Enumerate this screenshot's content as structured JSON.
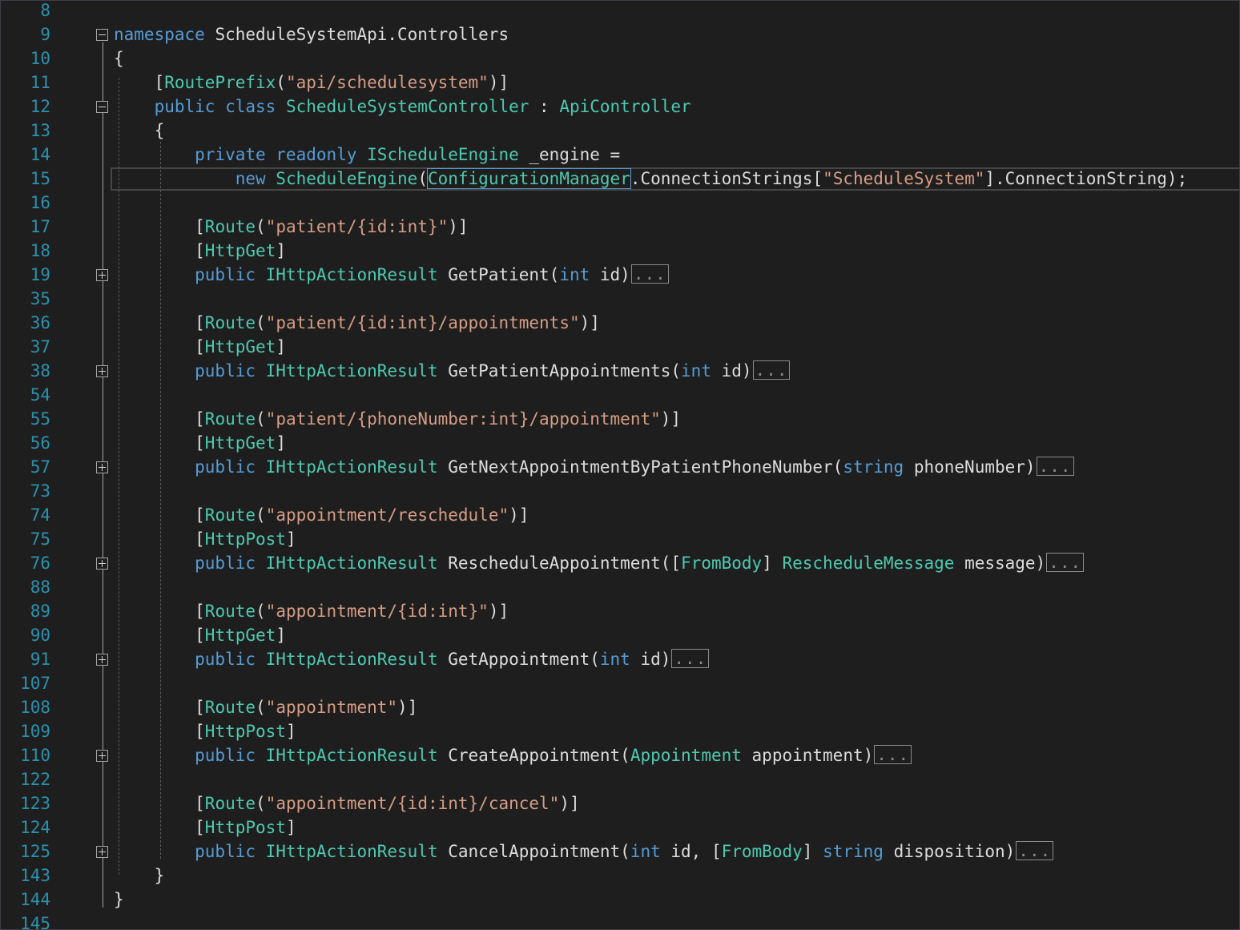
{
  "editor": {
    "colors": {
      "background": "#1e1e1e",
      "line_number": "#2b91af",
      "keyword": "#569cd6",
      "type": "#4ec9b0",
      "string": "#d69d85",
      "plain": "#dcdcdc"
    },
    "collapsed_marker": "...",
    "lines": [
      {
        "num": "8",
        "tokens": []
      },
      {
        "num": "9",
        "fold": "minus",
        "tokens": [
          [
            "kw",
            "namespace"
          ],
          [
            "pl",
            " ScheduleSystemApi.Controllers"
          ]
        ]
      },
      {
        "num": "10",
        "tokens": [
          [
            "pl",
            "{"
          ]
        ]
      },
      {
        "num": "11",
        "tokens": [
          [
            "pl",
            "    ["
          ],
          [
            "ty",
            "RoutePrefix"
          ],
          [
            "pl",
            "("
          ],
          [
            "st",
            "\"api/schedulesystem\""
          ],
          [
            "pl",
            ")]"
          ]
        ]
      },
      {
        "num": "12",
        "fold": "minus",
        "tokens": [
          [
            "kw",
            "    public class "
          ],
          [
            "ty",
            "ScheduleSystemController"
          ],
          [
            "pl",
            " : "
          ],
          [
            "ty",
            "ApiController"
          ]
        ]
      },
      {
        "num": "13",
        "tokens": [
          [
            "pl",
            "    {"
          ]
        ]
      },
      {
        "num": "14",
        "tokens": [
          [
            "kw",
            "        private readonly "
          ],
          [
            "ty",
            "IScheduleEngine"
          ],
          [
            "pl",
            " _engine ="
          ]
        ]
      },
      {
        "num": "15",
        "tokens": [
          [
            "kw",
            "            new "
          ],
          [
            "ty",
            "ScheduleEngine"
          ],
          [
            "pl",
            "("
          ],
          [
            "tyhl",
            "ConfigurationManager"
          ],
          [
            "pl",
            ".ConnectionStrings["
          ],
          [
            "st",
            "\"ScheduleSystem\""
          ],
          [
            "pl",
            "].ConnectionString);"
          ]
        ]
      },
      {
        "num": "16",
        "tokens": []
      },
      {
        "num": "17",
        "tokens": [
          [
            "pl",
            "        ["
          ],
          [
            "ty",
            "Route"
          ],
          [
            "pl",
            "("
          ],
          [
            "st",
            "\"patient/{id:int}\""
          ],
          [
            "pl",
            ")]"
          ]
        ]
      },
      {
        "num": "18",
        "tokens": [
          [
            "pl",
            "        ["
          ],
          [
            "ty",
            "HttpGet"
          ],
          [
            "pl",
            "]"
          ]
        ]
      },
      {
        "num": "19",
        "fold": "plus",
        "collapsed": true,
        "tokens": [
          [
            "kw",
            "        public "
          ],
          [
            "ty",
            "IHttpActionResult"
          ],
          [
            "pl",
            " GetPatient("
          ],
          [
            "kw",
            "int"
          ],
          [
            "pl",
            " id)"
          ]
        ]
      },
      {
        "num": "35",
        "tokens": []
      },
      {
        "num": "36",
        "tokens": [
          [
            "pl",
            "        ["
          ],
          [
            "ty",
            "Route"
          ],
          [
            "pl",
            "("
          ],
          [
            "st",
            "\"patient/{id:int}/appointments\""
          ],
          [
            "pl",
            ")]"
          ]
        ]
      },
      {
        "num": "37",
        "tokens": [
          [
            "pl",
            "        ["
          ],
          [
            "ty",
            "HttpGet"
          ],
          [
            "pl",
            "]"
          ]
        ]
      },
      {
        "num": "38",
        "fold": "plus",
        "collapsed": true,
        "tokens": [
          [
            "kw",
            "        public "
          ],
          [
            "ty",
            "IHttpActionResult"
          ],
          [
            "pl",
            " GetPatientAppointments("
          ],
          [
            "kw",
            "int"
          ],
          [
            "pl",
            " id)"
          ]
        ]
      },
      {
        "num": "54",
        "tokens": []
      },
      {
        "num": "55",
        "tokens": [
          [
            "pl",
            "        ["
          ],
          [
            "ty",
            "Route"
          ],
          [
            "pl",
            "("
          ],
          [
            "st",
            "\"patient/{phoneNumber:int}/appointment\""
          ],
          [
            "pl",
            ")]"
          ]
        ]
      },
      {
        "num": "56",
        "tokens": [
          [
            "pl",
            "        ["
          ],
          [
            "ty",
            "HttpGet"
          ],
          [
            "pl",
            "]"
          ]
        ]
      },
      {
        "num": "57",
        "fold": "plus",
        "collapsed": true,
        "tokens": [
          [
            "kw",
            "        public "
          ],
          [
            "ty",
            "IHttpActionResult"
          ],
          [
            "pl",
            " GetNextAppointmentByPatientPhoneNumber("
          ],
          [
            "kw",
            "string"
          ],
          [
            "pl",
            " phoneNumber)"
          ]
        ]
      },
      {
        "num": "73",
        "tokens": []
      },
      {
        "num": "74",
        "tokens": [
          [
            "pl",
            "        ["
          ],
          [
            "ty",
            "Route"
          ],
          [
            "pl",
            "("
          ],
          [
            "st",
            "\"appointment/reschedule\""
          ],
          [
            "pl",
            ")]"
          ]
        ]
      },
      {
        "num": "75",
        "tokens": [
          [
            "pl",
            "        ["
          ],
          [
            "ty",
            "HttpPost"
          ],
          [
            "pl",
            "]"
          ]
        ]
      },
      {
        "num": "76",
        "fold": "plus",
        "collapsed": true,
        "tokens": [
          [
            "kw",
            "        public "
          ],
          [
            "ty",
            "IHttpActionResult"
          ],
          [
            "pl",
            " RescheduleAppointment(["
          ],
          [
            "ty",
            "FromBody"
          ],
          [
            "pl",
            "] "
          ],
          [
            "ty",
            "RescheduleMessage"
          ],
          [
            "pl",
            " message)"
          ]
        ]
      },
      {
        "num": "88",
        "tokens": []
      },
      {
        "num": "89",
        "tokens": [
          [
            "pl",
            "        ["
          ],
          [
            "ty",
            "Route"
          ],
          [
            "pl",
            "("
          ],
          [
            "st",
            "\"appointment/{id:int}\""
          ],
          [
            "pl",
            ")]"
          ]
        ]
      },
      {
        "num": "90",
        "tokens": [
          [
            "pl",
            "        ["
          ],
          [
            "ty",
            "HttpGet"
          ],
          [
            "pl",
            "]"
          ]
        ]
      },
      {
        "num": "91",
        "fold": "plus",
        "collapsed": true,
        "tokens": [
          [
            "kw",
            "        public "
          ],
          [
            "ty",
            "IHttpActionResult"
          ],
          [
            "pl",
            " GetAppointment("
          ],
          [
            "kw",
            "int"
          ],
          [
            "pl",
            " id)"
          ]
        ]
      },
      {
        "num": "107",
        "tokens": []
      },
      {
        "num": "108",
        "tokens": [
          [
            "pl",
            "        ["
          ],
          [
            "ty",
            "Route"
          ],
          [
            "pl",
            "("
          ],
          [
            "st",
            "\"appointment\""
          ],
          [
            "pl",
            ")]"
          ]
        ]
      },
      {
        "num": "109",
        "tokens": [
          [
            "pl",
            "        ["
          ],
          [
            "ty",
            "HttpPost"
          ],
          [
            "pl",
            "]"
          ]
        ]
      },
      {
        "num": "110",
        "fold": "plus",
        "collapsed": true,
        "tokens": [
          [
            "kw",
            "        public "
          ],
          [
            "ty",
            "IHttpActionResult"
          ],
          [
            "pl",
            " CreateAppointment("
          ],
          [
            "ty",
            "Appointment"
          ],
          [
            "pl",
            " appointment)"
          ]
        ]
      },
      {
        "num": "122",
        "tokens": []
      },
      {
        "num": "123",
        "tokens": [
          [
            "pl",
            "        ["
          ],
          [
            "ty",
            "Route"
          ],
          [
            "pl",
            "("
          ],
          [
            "st",
            "\"appointment/{id:int}/cancel\""
          ],
          [
            "pl",
            ")]"
          ]
        ]
      },
      {
        "num": "124",
        "tokens": [
          [
            "pl",
            "        ["
          ],
          [
            "ty",
            "HttpPost"
          ],
          [
            "pl",
            "]"
          ]
        ]
      },
      {
        "num": "125",
        "fold": "plus",
        "collapsed": true,
        "tokens": [
          [
            "kw",
            "        public "
          ],
          [
            "ty",
            "IHttpActionResult"
          ],
          [
            "pl",
            " CancelAppointment("
          ],
          [
            "kw",
            "int"
          ],
          [
            "pl",
            " id, ["
          ],
          [
            "ty",
            "FromBody"
          ],
          [
            "pl",
            "] "
          ],
          [
            "kw",
            "string"
          ],
          [
            "pl",
            " disposition)"
          ]
        ]
      },
      {
        "num": "143",
        "tokens": [
          [
            "pl",
            "    }"
          ]
        ]
      },
      {
        "num": "144",
        "tokens": [
          [
            "pl",
            "}"
          ]
        ]
      },
      {
        "num": "145",
        "tokens": []
      }
    ]
  }
}
